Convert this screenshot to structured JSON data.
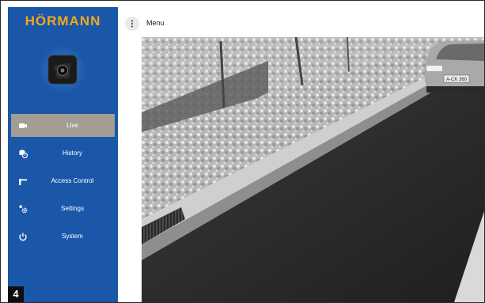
{
  "brand": {
    "name": "HÖRMANN",
    "color": "#f2a81d"
  },
  "colors": {
    "sidebar": "#1b57a8",
    "active_item": "#a39d93"
  },
  "topbar": {
    "menu_label": "Menu"
  },
  "sidebar": {
    "items": [
      {
        "label": "Live",
        "icon": "video-camera-icon",
        "active": true
      },
      {
        "label": "History",
        "icon": "history-icon",
        "active": false
      },
      {
        "label": "Access Control",
        "icon": "gate-barrier-icon",
        "active": false
      },
      {
        "label": "Settings",
        "icon": "settings-icon",
        "active": false
      },
      {
        "label": "System",
        "icon": "power-icon",
        "active": false
      }
    ]
  },
  "badge": {
    "label": "4"
  },
  "video": {
    "license_plate": "A-CK 360"
  }
}
